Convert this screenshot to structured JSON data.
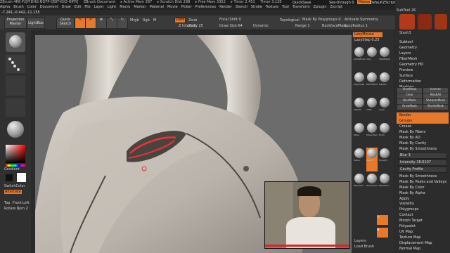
{
  "titlebar": {
    "items": [
      "ZBrush 4R8 P2[PIDHG-NOFP-QBIT-KIIO-HIFR]",
      "ZBrush Document",
      "▸ Active Mem 387",
      "▸ Scratch Disk 298",
      "▸ Free Mem 3352",
      "▸ Timer 2.451",
      "Timer 3.128"
    ],
    "quicksave": "QuickSave",
    "seethrough": "See-through 0",
    "menus_label": "Menus",
    "default_script": "DefaultZScript"
  },
  "menubar": [
    "Alpha",
    "Brush",
    "Color",
    "Document",
    "Draw",
    "Edit",
    "File",
    "Layer",
    "Light",
    "Macro",
    "Marker",
    "Material",
    "Movie",
    "Picker",
    "Preferences",
    "Render",
    "Stencil",
    "Stroke",
    "Texture",
    "Tool",
    "Transform",
    "Zplugin",
    "Zscript"
  ],
  "coords": "-7.241,-0.442,-11.155",
  "toolbar": {
    "projection_master": "Projection Master",
    "lightbox": "LightBox",
    "quick_sketch": "Quick Sketch",
    "edit": "Edit",
    "draw": "Draw",
    "move": "Move",
    "scale": "Scale",
    "rotate": "Rotate",
    "mrgb": "Mrgb",
    "rgb": "Rgb",
    "m": "M",
    "zadd": "Zadd",
    "zsub": "Zsub",
    "zcut": "Zcut",
    "focal_shift": "Focal Shift 0",
    "draw_size": "Draw Size 64",
    "z_intensity": "Z Intensity 25",
    "dynamic": "Dynamic",
    "topological": "Topological",
    "range": "Range 1",
    "backface_mask": "BackfaceMask",
    "auto_groups": "Auto Groups",
    "mask_by_polygroups": "Mask By Polygroups 0",
    "activate_symmetry": "Activate Symmetry",
    "lazy_radius": "LazyRadius 1"
  },
  "left": {
    "gradient": "Gradient",
    "switch_color": "SwitchColor",
    "alternate": "Alternate",
    "top": "Top",
    "front": "Front",
    "left": "Left",
    "rotate_z": "Rotate Z",
    "sym_z": "Sym Z"
  },
  "right_panel": {
    "lazymouse": "LazyMouse",
    "lazystep": "LazyStep 0.25",
    "brushes": [
      "AlphaBrush",
      "Clay",
      "ClayBuildup",
      "ClayTubes",
      "DamStandard",
      "Flatten",
      "hPolish",
      "Inflat",
      "Layer",
      "Move",
      "Move Topological",
      "Pinch",
      "Polish",
      "Slash3",
      "Smooth",
      "Standard",
      "TrimDynamic",
      "ZModeler"
    ],
    "layers_label": "Layers",
    "default_label": "Default",
    "load_brush": "Load Brush",
    "save_brush": "Save Brush",
    "selected_brush": "Slash3"
  },
  "far_right": {
    "subtool_header": "SubTool 26",
    "brush_name": "Slash3",
    "sections": [
      "Subtool",
      "Geometry",
      "Layers",
      "FiberMesh",
      "Geometry HD",
      "Preview",
      "Surface",
      "Deformation",
      "Masking"
    ],
    "mask_rows": [
      [
        "ViewMask",
        "Inverse"
      ],
      [
        "Clear",
        "MaskAll"
      ],
      [
        "BlurMask",
        "SharpenMask"
      ],
      [
        "GrowMask",
        "ShrinkMask"
      ]
    ],
    "mask_by_cavity_header": "Mask By Cavity",
    "items_mid": [
      "Border",
      "Groups",
      "Crease",
      "Mask By Fibers",
      "Mask By AO",
      "Mask By Cavity",
      "Mask By Smoothness"
    ],
    "blur_label": "Blur 3",
    "intensity": "Intensity 18.6107",
    "cavity_profile": "Cavity Profile",
    "items_low": [
      "Mask By Smoothness",
      "Mask By Peaks and Valleys",
      "Mask By Color",
      "Mask By Alpha",
      "Apply"
    ],
    "items_bottom": [
      "Visibility",
      "Polygroups",
      "Contact",
      "Morph Target",
      "Polypaint",
      "UV Map",
      "Texture Map",
      "Displacement Map",
      "Normal Map"
    ]
  },
  "colors": {
    "accent": "#e8782a",
    "panel": "#2e2e2e",
    "viewport": "#6c6c6c"
  }
}
